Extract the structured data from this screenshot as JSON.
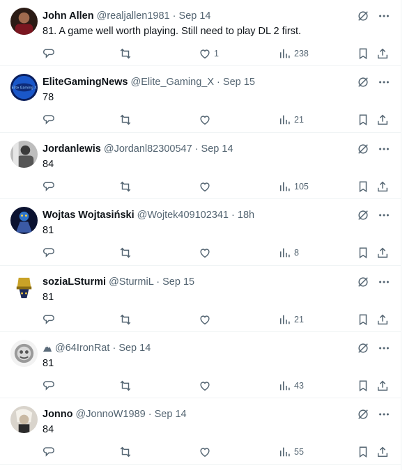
{
  "colors": {
    "text": "#0f1419",
    "secondary": "#536471",
    "divider": "#eff3f4"
  },
  "icons": {
    "reply": "reply-icon",
    "retweet": "retweet-icon",
    "like": "heart-icon",
    "views": "views-icon",
    "bookmark": "bookmark-icon",
    "share": "share-icon",
    "grok": "grok-icon",
    "more": "more-icon"
  },
  "tweets": [
    {
      "name": "John Allen",
      "handle": "@realjallen1981",
      "time": "Sep 14",
      "text": "81. A game well worth playing. Still need to play DL 2 first.",
      "likes": "1",
      "views": "238"
    },
    {
      "name": "EliteGamingNews",
      "handle": "@Elite_Gaming_X",
      "time": "Sep 15",
      "text": "78",
      "likes": "",
      "views": "21"
    },
    {
      "name": "Jordanlewis",
      "handle": "@Jordanl82300547",
      "time": "Sep 14",
      "text": "84",
      "likes": "",
      "views": "105"
    },
    {
      "name": "Wojtas Wojtasiński",
      "handle": "@Wojtek409102341",
      "time": "18h",
      "text": "81",
      "likes": "",
      "views": "8"
    },
    {
      "name": "soziaLSturmi",
      "handle": "@SturmiL",
      "time": "Sep 15",
      "text": "81",
      "likes": "",
      "views": "21"
    },
    {
      "name": "",
      "handle": "@64IronRat",
      "time": "Sep 14",
      "text": "81",
      "likes": "",
      "views": "43"
    },
    {
      "name": "Jonno",
      "handle": "@JonnoW1989",
      "time": "Sep 14",
      "text": "84",
      "likes": "",
      "views": "55"
    }
  ]
}
